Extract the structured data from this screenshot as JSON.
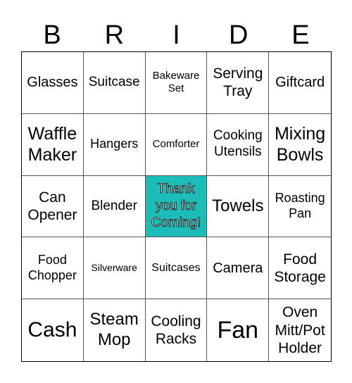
{
  "header": [
    "B",
    "R",
    "I",
    "D",
    "E"
  ],
  "cells": [
    "Glasses",
    "Suitcase",
    "Bakeware Set",
    "Serving Tray",
    "Giftcard",
    "Waffle Maker",
    "Hangers",
    "Comforter",
    "Cooking Utensils",
    "Mixing Bowls",
    "Can Opener",
    "Blender",
    "Thank you for Coming!",
    "Towels",
    "Roasting Pan",
    "Food Chopper",
    "Silverware",
    "Suitcases",
    "Camera",
    "Food Storage",
    "Cash",
    "Steam Mop",
    "Cooling Racks",
    "Fan",
    "Oven Mitt/Pot Holder"
  ],
  "free_space_index": 12,
  "colors": {
    "free_space": "#1cbcb8"
  }
}
